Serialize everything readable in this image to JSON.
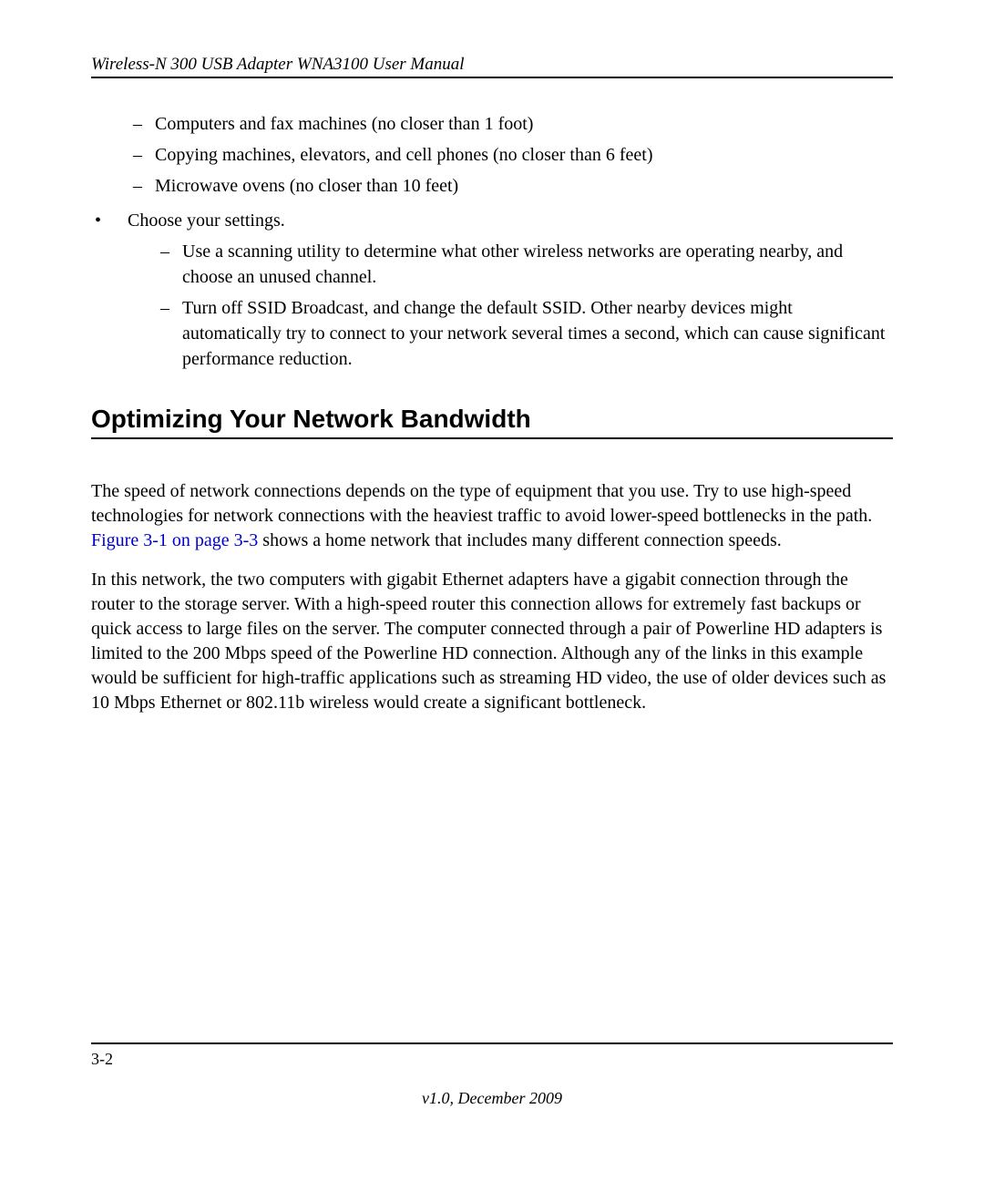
{
  "header": {
    "running_title": "Wireless-N 300 USB Adapter WNA3100 User Manual"
  },
  "top_sub_items": [
    "Computers and fax machines (no closer than 1 foot)",
    "Copying machines, elevators, and cell phones (no closer than 6 feet)",
    "Microwave ovens (no closer than 10 feet)"
  ],
  "main_bullet": {
    "text": "Choose your settings.",
    "sub_items": [
      "Use a scanning utility to determine what other wireless networks are operating nearby, and choose an unused channel.",
      "Turn off SSID Broadcast, and change the default SSID. Other nearby devices might automatically try to connect to your network several times a second, which can cause significant performance reduction."
    ]
  },
  "section": {
    "heading": "Optimizing Your Network Bandwidth",
    "para1_prefix": "The speed of network connections depends on the type of equipment that you use. Try to use high-speed technologies for network connections with the heaviest traffic to avoid lower-speed bottlenecks in the path. ",
    "para1_link": "Figure 3-1 on page 3-3",
    "para1_suffix": " shows a home network that includes many different connection speeds.",
    "para2": "In this network, the two computers with gigabit Ethernet adapters have a gigabit connection through the router to the storage server. With a high-speed router this connection allows for extremely fast backups or quick access to large files on the server. The computer connected through a pair of Powerline HD adapters is limited to the 200 Mbps speed of the Powerline HD connection. Although any of the links in this example would be sufficient for high-traffic applications such as streaming HD video, the use of older devices such as 10 Mbps Ethernet or 802.11b wireless would create a significant bottleneck."
  },
  "footer": {
    "page_number": "3-2",
    "version": "v1.0, December 2009"
  }
}
